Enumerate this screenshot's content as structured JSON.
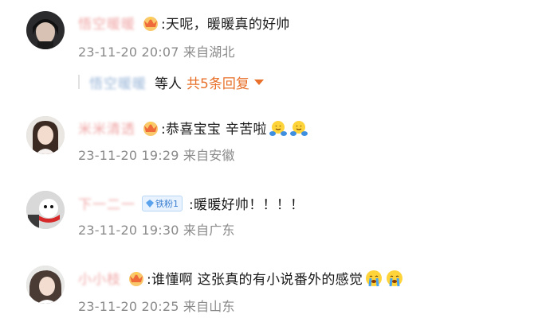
{
  "comments": [
    {
      "username": "悟空暖暖",
      "text": ":天呢，暖暖真的好帅",
      "meta": "23-11-20 20:07 来自湖北",
      "replies": {
        "user": "悟空暖暖",
        "suffix": "等人",
        "count": "共5条回复"
      }
    },
    {
      "username": "米米清透",
      "text": ":恭喜宝宝 辛苦啦",
      "meta": "23-11-20 19:29 来自安徽"
    },
    {
      "username": "下一二一",
      "fan_badge": "铁粉1",
      "text": ":暖暖好帅！！！！",
      "meta": "23-11-20 19:30 来自广东"
    },
    {
      "username": "小小枝",
      "text": ":谁懂啊 这张真的有小说番外的感觉",
      "meta": "23-11-20 20:25 来自山东"
    }
  ],
  "colors": {
    "accent": "#e8702a",
    "meta": "#8a8a8a",
    "fan_badge": "#3c7fd0"
  },
  "icons": [
    "crown-badge-icon",
    "diamond-icon",
    "hug-emoji-icon",
    "crying-emoji-icon",
    "caret-down-icon"
  ]
}
